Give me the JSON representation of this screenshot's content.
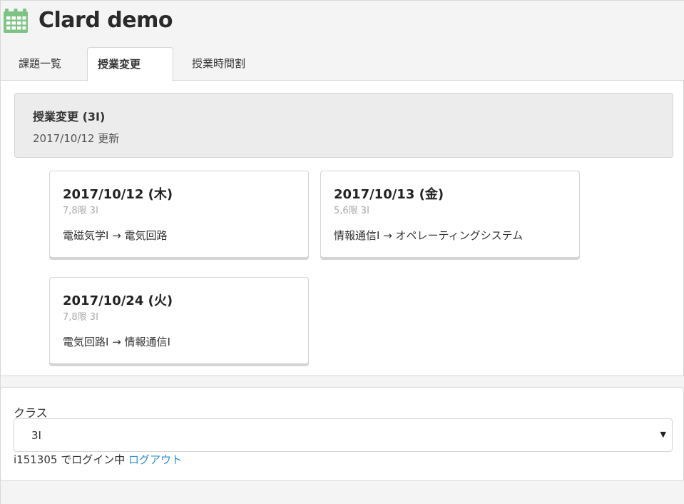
{
  "app": {
    "title": "Clard demo",
    "icon": "calendar-icon",
    "icon_color": "#7dc383"
  },
  "tabs": [
    {
      "label": "課題一覧",
      "active": false
    },
    {
      "label": "授業変更",
      "active": true
    },
    {
      "label": "授業時間割",
      "active": false
    }
  ],
  "notice": {
    "title": "授業変更 (3I)",
    "subtitle": "2017/10/12 更新"
  },
  "changes": [
    {
      "date": "2017/10/12 (木)",
      "meta": "7,8限 3I",
      "change": "電磁気学I → 電気回路"
    },
    {
      "date": "2017/10/13 (金)",
      "meta": "5,6限 3I",
      "change": "情報通信I → オペレーティングシステム"
    },
    {
      "date": "2017/10/24 (火)",
      "meta": "7,8限 3I",
      "change": "電気回路I → 情報通信I"
    }
  ],
  "class_select": {
    "label": "クラス",
    "value": "3I"
  },
  "login": {
    "text": "i151305 でログイン中",
    "logout_label": "ログアウト",
    "link_color": "#2a8fd1"
  }
}
